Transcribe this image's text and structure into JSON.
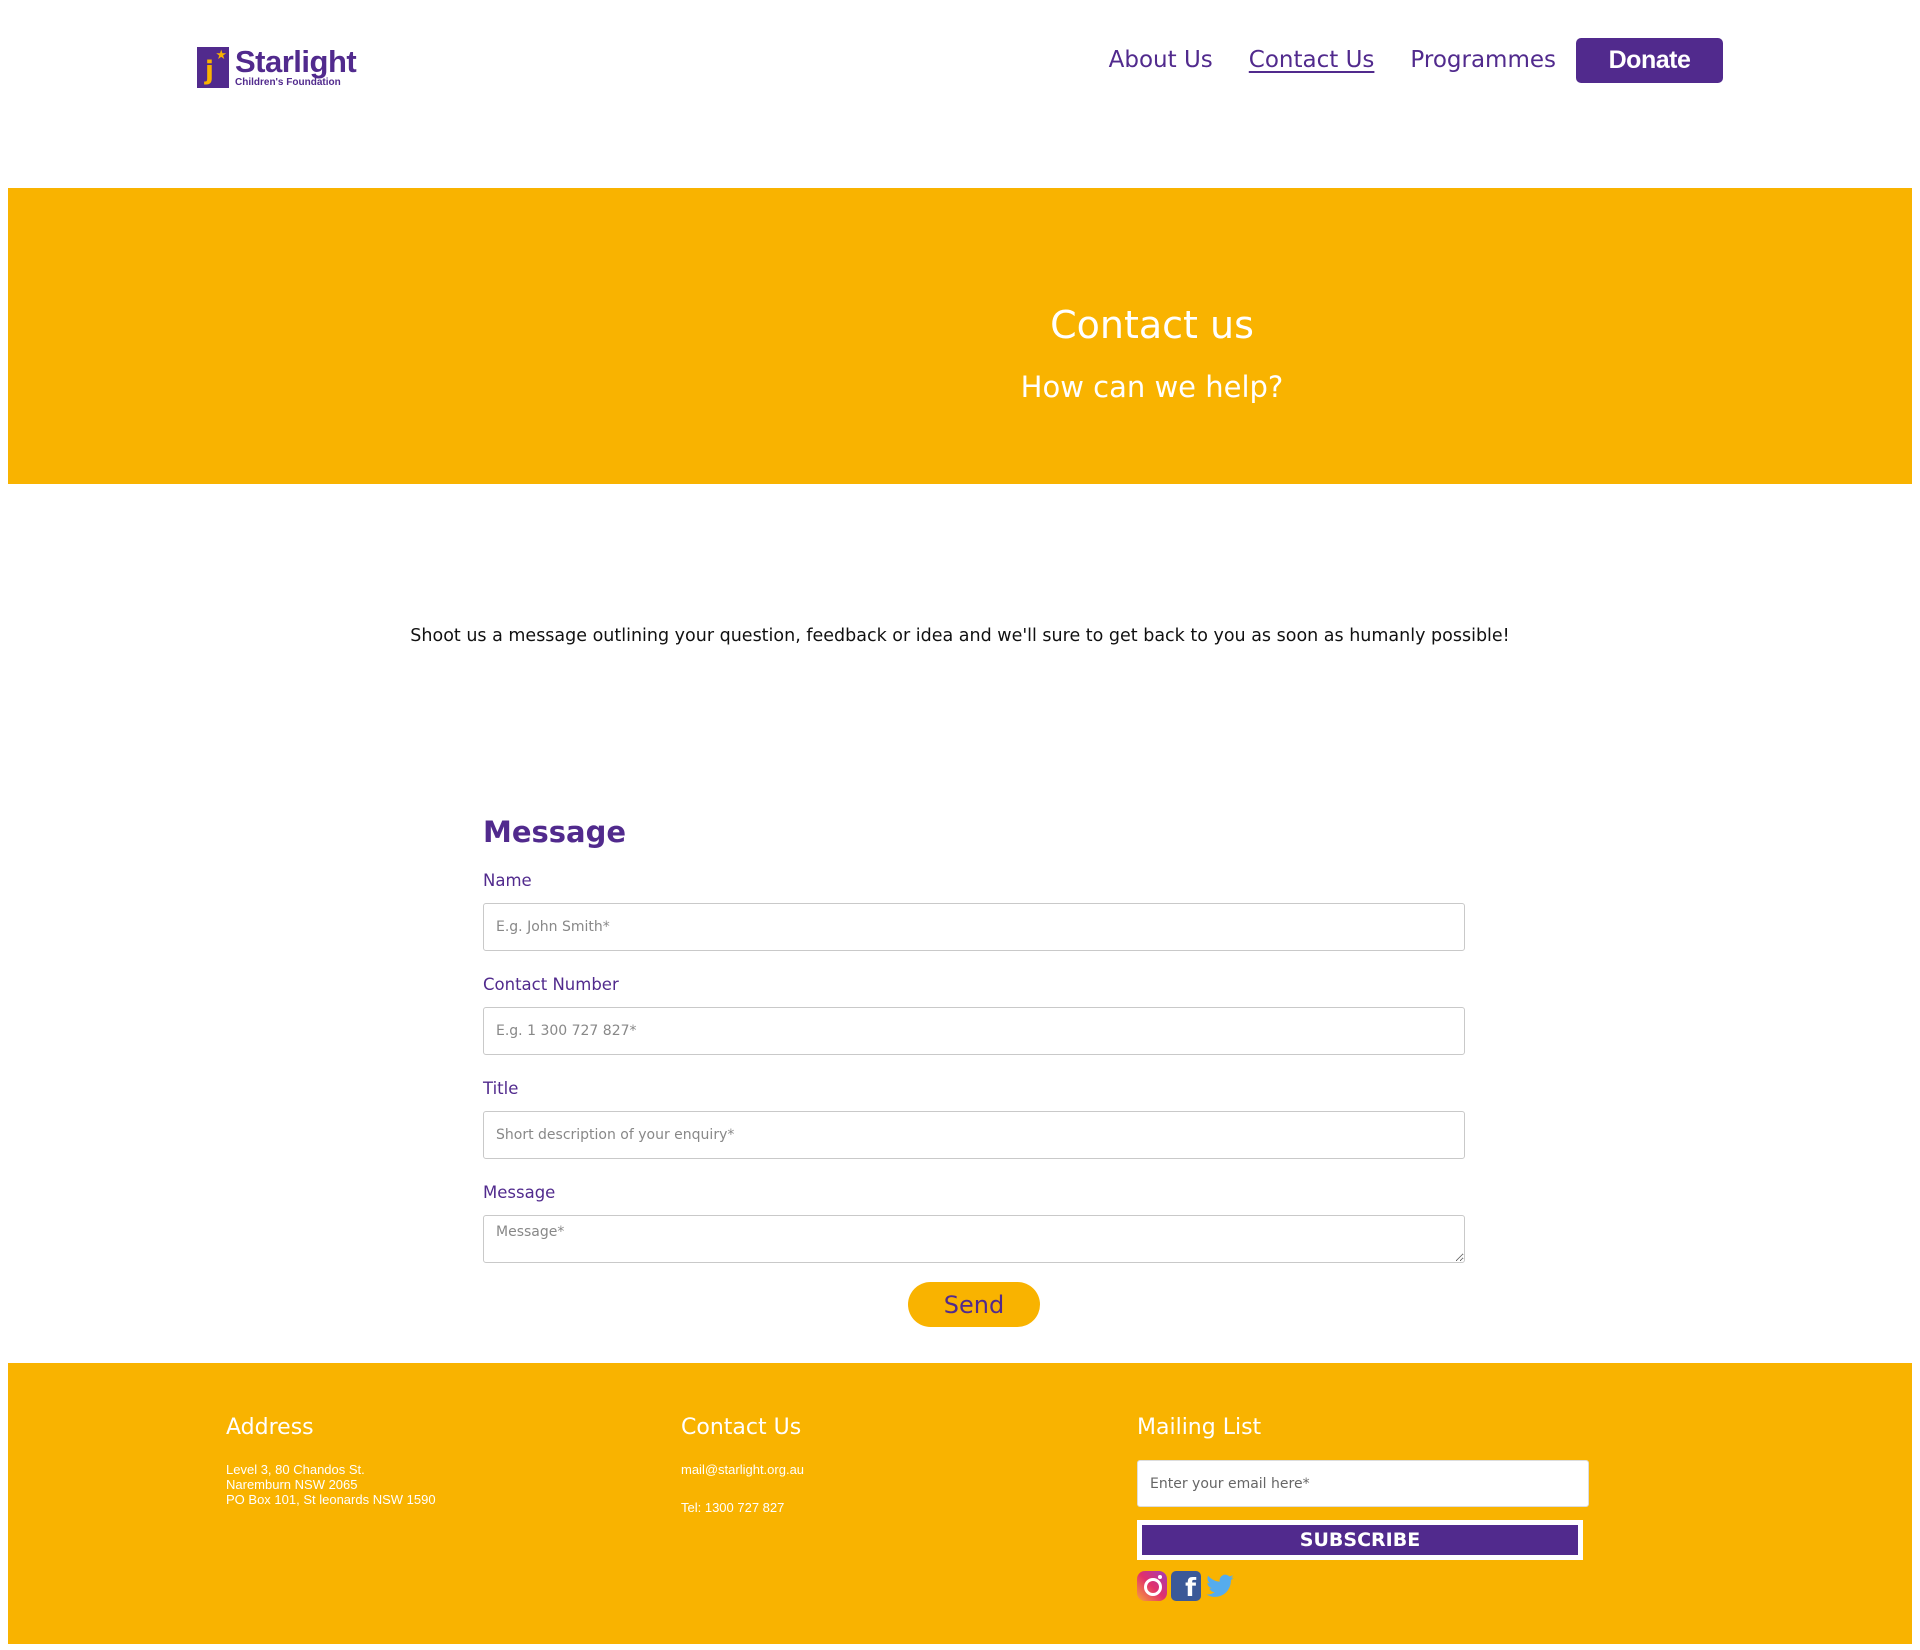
{
  "brand": {
    "name": "Starlight",
    "subtitle": "Children's Foundation",
    "logo_icon": "starlight-logo-icon",
    "purple": "#512a8d",
    "yellow": "#f9b300"
  },
  "nav": {
    "items": [
      {
        "label": "About Us",
        "active": false
      },
      {
        "label": "Contact Us",
        "active": true
      },
      {
        "label": "Programmes",
        "active": false
      }
    ],
    "donate_label": "Donate"
  },
  "hero": {
    "title": "Contact us",
    "subtitle": "How can we help?"
  },
  "intro": {
    "text": "Shoot us a message outlining your question, feedback or idea and we'll sure to get back to you as soon as humanly possible!"
  },
  "form": {
    "title": "Message",
    "fields": [
      {
        "label": "Name",
        "placeholder": "E.g. John Smith*",
        "value": ""
      },
      {
        "label": "Contact Number",
        "placeholder": "E.g. 1 300 727 827*",
        "value": ""
      },
      {
        "label": "Title",
        "placeholder": "Short description of your enquiry*",
        "value": ""
      },
      {
        "label": "Message",
        "placeholder": "Message*",
        "value": ""
      }
    ],
    "send_label": "Send"
  },
  "footer": {
    "address": {
      "heading": "Address",
      "lines": [
        "Level 3, 80 Chandos St.",
        "Naremburn NSW 2065",
        "PO Box 101, St leonards NSW 1590"
      ]
    },
    "contact": {
      "heading": "Contact Us",
      "email": "mail@starlight.org.au",
      "phone": "Tel: 1300 727 827"
    },
    "mailing": {
      "heading": "Mailing List",
      "placeholder": "Enter your email here*",
      "value": "",
      "subscribe_label": "SUBSCRIBE"
    },
    "socials": [
      "instagram-icon",
      "facebook-icon",
      "twitter-icon"
    ]
  }
}
